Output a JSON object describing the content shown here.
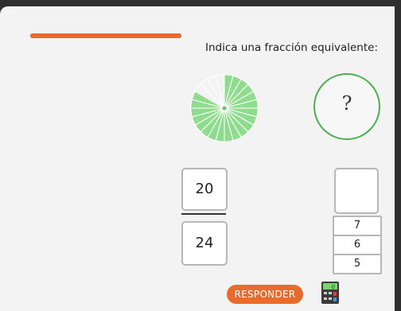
{
  "progress": {
    "fraction": 1.0,
    "color": "#e86a2c"
  },
  "prompt": "Indica una fracción equivalente:",
  "pie": {
    "slices": 24,
    "shaded": 20,
    "fill_color": "#8fdc8f",
    "line_color": "#ffffff"
  },
  "question_circle": {
    "symbol": "?",
    "border_color": "#4caf50"
  },
  "fraction": {
    "numerator": "20",
    "denominator": "24"
  },
  "answer_box": {
    "value": ""
  },
  "options": [
    "7",
    "6",
    "5"
  ],
  "respond_button": {
    "label": "RESPONDER",
    "color": "#e86a2c"
  },
  "calculator": {
    "icon": "calculator-icon",
    "display": "0"
  }
}
